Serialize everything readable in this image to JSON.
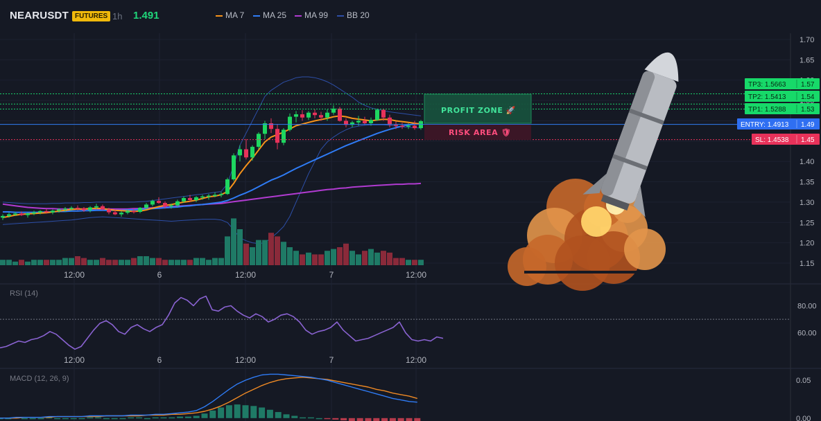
{
  "header": {
    "symbol": "NEARUSDT",
    "badge": "FUTURES",
    "timeframe": "1h",
    "price": "1.491",
    "legend": [
      {
        "label": "MA 7",
        "color": "#f7931a"
      },
      {
        "label": "MA 25",
        "color": "#2f7cf6"
      },
      {
        "label": "MA 99",
        "color": "#b13bd1"
      },
      {
        "label": "BB 20",
        "color": "#2d4fa8"
      }
    ]
  },
  "colors": {
    "up": "#26a269",
    "up_bright": "#1ed760",
    "down": "#e8325a",
    "vol_up": "#1f7a66",
    "vol_down": "#8a2a3a"
  },
  "chart_data": [
    {
      "type": "line",
      "pane": "price",
      "y_ticks": [
        "1.70",
        "1.65",
        "1.60",
        "1.55",
        "1.50",
        "1.45",
        "1.40",
        "1.35",
        "1.30",
        "1.25",
        "1.20",
        "1.15"
      ],
      "ylim": [
        1.15,
        1.7
      ],
      "x_ticks": [
        "12:00",
        "6",
        "12:00",
        "7",
        "12:00"
      ],
      "candles": [
        [
          1.262,
          1.27,
          1.256,
          1.266
        ],
        [
          1.266,
          1.274,
          1.262,
          1.27
        ],
        [
          1.27,
          1.276,
          1.266,
          1.272
        ],
        [
          1.272,
          1.277,
          1.266,
          1.268
        ],
        [
          1.268,
          1.274,
          1.262,
          1.272
        ],
        [
          1.272,
          1.279,
          1.268,
          1.275
        ],
        [
          1.275,
          1.28,
          1.27,
          1.278
        ],
        [
          1.278,
          1.283,
          1.272,
          1.275
        ],
        [
          1.275,
          1.282,
          1.27,
          1.279
        ],
        [
          1.279,
          1.285,
          1.274,
          1.282
        ],
        [
          1.282,
          1.288,
          1.276,
          1.284
        ],
        [
          1.284,
          1.29,
          1.279,
          1.286
        ],
        [
          1.286,
          1.292,
          1.28,
          1.285
        ],
        [
          1.285,
          1.288,
          1.276,
          1.28
        ],
        [
          1.28,
          1.29,
          1.275,
          1.287
        ],
        [
          1.287,
          1.296,
          1.282,
          1.29
        ],
        [
          1.29,
          1.294,
          1.28,
          1.282
        ],
        [
          1.282,
          1.286,
          1.27,
          1.275
        ],
        [
          1.275,
          1.282,
          1.268,
          1.27
        ],
        [
          1.27,
          1.278,
          1.264,
          1.274
        ],
        [
          1.274,
          1.282,
          1.27,
          1.278
        ],
        [
          1.278,
          1.284,
          1.272,
          1.276
        ],
        [
          1.276,
          1.288,
          1.273,
          1.286
        ],
        [
          1.286,
          1.298,
          1.282,
          1.294
        ],
        [
          1.294,
          1.306,
          1.29,
          1.303
        ],
        [
          1.303,
          1.312,
          1.296,
          1.298
        ],
        [
          1.298,
          1.302,
          1.284,
          1.29
        ],
        [
          1.29,
          1.296,
          1.284,
          1.292
        ],
        [
          1.292,
          1.306,
          1.288,
          1.302
        ],
        [
          1.302,
          1.314,
          1.298,
          1.31
        ],
        [
          1.31,
          1.318,
          1.3,
          1.305
        ],
        [
          1.305,
          1.315,
          1.3,
          1.312
        ],
        [
          1.312,
          1.318,
          1.306,
          1.314
        ],
        [
          1.314,
          1.32,
          1.306,
          1.316
        ],
        [
          1.316,
          1.324,
          1.312,
          1.318
        ],
        [
          1.318,
          1.325,
          1.312,
          1.32
        ],
        [
          1.32,
          1.36,
          1.318,
          1.356
        ],
        [
          1.356,
          1.42,
          1.352,
          1.415
        ],
        [
          1.415,
          1.44,
          1.4,
          1.43
        ],
        [
          1.43,
          1.455,
          1.405,
          1.41
        ],
        [
          1.41,
          1.44,
          1.402,
          1.436
        ],
        [
          1.436,
          1.472,
          1.43,
          1.468
        ],
        [
          1.468,
          1.5,
          1.455,
          1.494
        ],
        [
          1.494,
          1.506,
          1.47,
          1.48
        ],
        [
          1.48,
          1.492,
          1.43,
          1.446
        ],
        [
          1.446,
          1.482,
          1.44,
          1.478
        ],
        [
          1.478,
          1.518,
          1.474,
          1.51
        ],
        [
          1.51,
          1.524,
          1.496,
          1.516
        ],
        [
          1.516,
          1.526,
          1.5,
          1.508
        ],
        [
          1.508,
          1.524,
          1.502,
          1.52
        ],
        [
          1.52,
          1.528,
          1.506,
          1.514
        ],
        [
          1.514,
          1.522,
          1.5,
          1.508
        ],
        [
          1.508,
          1.528,
          1.5,
          1.52
        ],
        [
          1.52,
          1.538,
          1.515,
          1.53
        ],
        [
          1.53,
          1.534,
          1.498,
          1.5
        ],
        [
          1.5,
          1.506,
          1.484,
          1.49
        ],
        [
          1.49,
          1.5,
          1.484,
          1.496
        ],
        [
          1.496,
          1.512,
          1.488,
          1.5
        ],
        [
          1.5,
          1.51,
          1.49,
          1.494
        ],
        [
          1.494,
          1.508,
          1.488,
          1.502
        ],
        [
          1.502,
          1.53,
          1.5,
          1.527
        ],
        [
          1.527,
          1.53,
          1.5,
          1.508
        ],
        [
          1.508,
          1.515,
          1.484,
          1.49
        ],
        [
          1.49,
          1.498,
          1.48,
          1.488
        ],
        [
          1.488,
          1.495,
          1.48,
          1.486
        ],
        [
          1.486,
          1.494,
          1.48,
          1.488
        ],
        [
          1.488,
          1.5,
          1.478,
          1.482
        ],
        [
          1.482,
          1.502,
          1.478,
          1.499
        ]
      ],
      "volume": [
        3,
        3,
        2,
        3,
        2,
        3,
        3,
        3,
        3,
        3,
        4,
        4,
        5,
        4,
        3,
        3,
        4,
        3,
        3,
        3,
        3,
        4,
        5,
        5,
        4,
        4,
        3,
        3,
        3,
        3,
        3,
        4,
        4,
        3,
        4,
        4,
        16,
        26,
        20,
        12,
        10,
        14,
        14,
        18,
        16,
        13,
        10,
        8,
        6,
        7,
        6,
        6,
        8,
        9,
        10,
        12,
        8,
        6,
        8,
        9,
        7,
        8,
        7,
        4,
        4,
        3,
        3,
        3
      ],
      "ma7": [
        1.262,
        1.265,
        1.268,
        1.27,
        1.271,
        1.272,
        1.273,
        1.274,
        1.276,
        1.278,
        1.28,
        1.282,
        1.283,
        1.283,
        1.284,
        1.285,
        1.284,
        1.282,
        1.28,
        1.279,
        1.278,
        1.277,
        1.278,
        1.281,
        1.285,
        1.289,
        1.292,
        1.294,
        1.297,
        1.3,
        1.302,
        1.305,
        1.309,
        1.313,
        1.315,
        1.318,
        1.326,
        1.346,
        1.37,
        1.39,
        1.408,
        1.428,
        1.448,
        1.46,
        1.466,
        1.472,
        1.48,
        1.488,
        1.492,
        1.496,
        1.5,
        1.503,
        1.506,
        1.51,
        1.512,
        1.51,
        1.506,
        1.504,
        1.502,
        1.5,
        1.502,
        1.504,
        1.503,
        1.5,
        1.498,
        1.496,
        1.494,
        1.492
      ],
      "ma25": [
        1.276,
        1.276,
        1.275,
        1.275,
        1.275,
        1.275,
        1.275,
        1.276,
        1.276,
        1.277,
        1.277,
        1.278,
        1.278,
        1.279,
        1.279,
        1.28,
        1.28,
        1.28,
        1.28,
        1.28,
        1.281,
        1.281,
        1.282,
        1.283,
        1.284,
        1.285,
        1.286,
        1.287,
        1.288,
        1.29,
        1.291,
        1.293,
        1.294,
        1.296,
        1.298,
        1.3,
        1.304,
        1.31,
        1.317,
        1.323,
        1.33,
        1.338,
        1.346,
        1.354,
        1.36,
        1.367,
        1.375,
        1.383,
        1.39,
        1.397,
        1.404,
        1.411,
        1.418,
        1.425,
        1.432,
        1.439,
        1.445,
        1.451,
        1.457,
        1.463,
        1.469,
        1.474,
        1.479,
        1.483,
        1.487,
        1.49,
        1.492,
        1.494
      ],
      "ma99": [
        1.295,
        1.293,
        1.291,
        1.289,
        1.287,
        1.286,
        1.285,
        1.284,
        1.284,
        1.283,
        1.283,
        1.283,
        1.283,
        1.283,
        1.283,
        1.283,
        1.283,
        1.283,
        1.283,
        1.283,
        1.283,
        1.284,
        1.284,
        1.285,
        1.286,
        1.287,
        1.288,
        1.289,
        1.29,
        1.291,
        1.292,
        1.293,
        1.294,
        1.295,
        1.296,
        1.297,
        1.299,
        1.301,
        1.303,
        1.305,
        1.307,
        1.309,
        1.311,
        1.313,
        1.315,
        1.317,
        1.319,
        1.321,
        1.323,
        1.325,
        1.327,
        1.329,
        1.331,
        1.332,
        1.334,
        1.335,
        1.337,
        1.338,
        1.339,
        1.34,
        1.341,
        1.342,
        1.343,
        1.344,
        1.344,
        1.345,
        1.345,
        1.346
      ],
      "bb_upper": [
        1.3,
        1.299,
        1.298,
        1.297,
        1.296,
        1.296,
        1.296,
        1.296,
        1.297,
        1.297,
        1.298,
        1.298,
        1.298,
        1.299,
        1.299,
        1.3,
        1.3,
        1.3,
        1.3,
        1.3,
        1.3,
        1.3,
        1.301,
        1.302,
        1.304,
        1.306,
        1.308,
        1.31,
        1.312,
        1.314,
        1.316,
        1.318,
        1.32,
        1.322,
        1.324,
        1.326,
        1.345,
        1.39,
        1.44,
        1.47,
        1.5,
        1.53,
        1.56,
        1.575,
        1.585,
        1.595,
        1.6,
        1.606,
        1.608,
        1.608,
        1.606,
        1.602,
        1.596,
        1.588,
        1.578,
        1.568,
        1.558,
        1.546,
        1.538,
        1.532,
        1.528,
        1.525,
        1.522,
        1.52,
        1.518,
        1.516,
        1.514,
        1.512
      ],
      "bb_lower": [
        1.245,
        1.246,
        1.247,
        1.248,
        1.249,
        1.25,
        1.251,
        1.252,
        1.253,
        1.254,
        1.255,
        1.256,
        1.258,
        1.26,
        1.262,
        1.263,
        1.264,
        1.263,
        1.262,
        1.261,
        1.26,
        1.259,
        1.258,
        1.257,
        1.256,
        1.255,
        1.254,
        1.253,
        1.254,
        1.255,
        1.256,
        1.257,
        1.258,
        1.258,
        1.258,
        1.256,
        1.25,
        1.232,
        1.212,
        1.205,
        1.2,
        1.198,
        1.2,
        1.212,
        1.225,
        1.24,
        1.265,
        1.3,
        1.335,
        1.37,
        1.4,
        1.43,
        1.448,
        1.46,
        1.47,
        1.478,
        1.484,
        1.487,
        1.489,
        1.49,
        1.49,
        1.49,
        1.489,
        1.487,
        1.485,
        1.484,
        1.483,
        1.482
      ],
      "levels": [
        {
          "label": "TP3: 1.5663",
          "axis": "1.57",
          "value": 1.5663,
          "kind": "tp"
        },
        {
          "label": "TP2: 1.5413",
          "axis": "1.54",
          "value": 1.5413,
          "kind": "tp"
        },
        {
          "label": "TP1: 1.5288",
          "axis": "1.53",
          "value": 1.5288,
          "kind": "tp"
        },
        {
          "label": "ENTRY: 1.4913",
          "axis": "1.49",
          "value": 1.4913,
          "kind": "entry"
        },
        {
          "label": "SL: 1.4538",
          "axis": "1.45",
          "value": 1.4538,
          "kind": "sl"
        }
      ],
      "zones": {
        "profit": "PROFIT ZONE 🚀",
        "risk": "RISK AREA 🛡"
      }
    },
    {
      "type": "line",
      "pane": "rsi",
      "title": "RSI (14)",
      "y_ticks": [
        "80.00",
        "60.00"
      ],
      "ylim": [
        40,
        95
      ],
      "reference": 70,
      "values": [
        49,
        50,
        52,
        54,
        53,
        55,
        56,
        58,
        61,
        59,
        55,
        51,
        48,
        50,
        56,
        62,
        67,
        69,
        66,
        61,
        59,
        64,
        66,
        63,
        61,
        64,
        66,
        73,
        82,
        86,
        84,
        80,
        85,
        87,
        77,
        76,
        79,
        80,
        76,
        73,
        71,
        74,
        72,
        68,
        70,
        73,
        74,
        72,
        68,
        62,
        59,
        61,
        62,
        64,
        68,
        62,
        58,
        54,
        55,
        56,
        58,
        60,
        62,
        64,
        68,
        60,
        55,
        54,
        55,
        54,
        57,
        56
      ]
    },
    {
      "type": "line",
      "pane": "macd",
      "title": "MACD (12, 26, 9)",
      "y_ticks": [
        "0.05",
        "0.00"
      ],
      "ylim": [
        -0.002,
        0.062
      ],
      "macd": [
        0.0,
        0.0,
        0.001,
        0.001,
        0.001,
        0.001,
        0.002,
        0.002,
        0.002,
        0.002,
        0.002,
        0.003,
        0.003,
        0.003,
        0.003,
        0.003,
        0.004,
        0.004,
        0.004,
        0.005,
        0.005,
        0.006,
        0.007,
        0.008,
        0.01,
        0.015,
        0.022,
        0.03,
        0.038,
        0.045,
        0.05,
        0.054,
        0.057,
        0.058,
        0.058,
        0.057,
        0.056,
        0.055,
        0.054,
        0.052,
        0.05,
        0.047,
        0.044,
        0.041,
        0.038,
        0.035,
        0.032,
        0.029,
        0.026,
        0.024,
        0.022,
        0.021
      ],
      "signal": [
        0.0,
        0.0,
        0.0,
        0.001,
        0.001,
        0.001,
        0.001,
        0.002,
        0.002,
        0.002,
        0.002,
        0.002,
        0.002,
        0.003,
        0.003,
        0.003,
        0.003,
        0.003,
        0.004,
        0.004,
        0.004,
        0.005,
        0.005,
        0.006,
        0.007,
        0.009,
        0.012,
        0.016,
        0.021,
        0.027,
        0.033,
        0.038,
        0.043,
        0.047,
        0.05,
        0.052,
        0.053,
        0.054,
        0.053,
        0.052,
        0.051,
        0.049,
        0.047,
        0.045,
        0.043,
        0.041,
        0.038,
        0.036,
        0.033,
        0.031,
        0.029,
        0.026
      ],
      "histogram": [
        0,
        0,
        0.001,
        0,
        0,
        0,
        0.001,
        0,
        0,
        0,
        0,
        0.001,
        0.001,
        0,
        0,
        0,
        0.001,
        0.001,
        0,
        0.001,
        0.001,
        0.001,
        0.002,
        0.002,
        0.003,
        0.006,
        0.01,
        0.014,
        0.017,
        0.018,
        0.017,
        0.016,
        0.014,
        0.011,
        0.008,
        0.005,
        0.003,
        0.001,
        0.001,
        0,
        -0.001,
        -0.002,
        -0.003,
        -0.004,
        -0.005,
        -0.006,
        -0.006,
        -0.007,
        -0.007,
        -0.007,
        -0.007,
        -0.005
      ]
    }
  ]
}
